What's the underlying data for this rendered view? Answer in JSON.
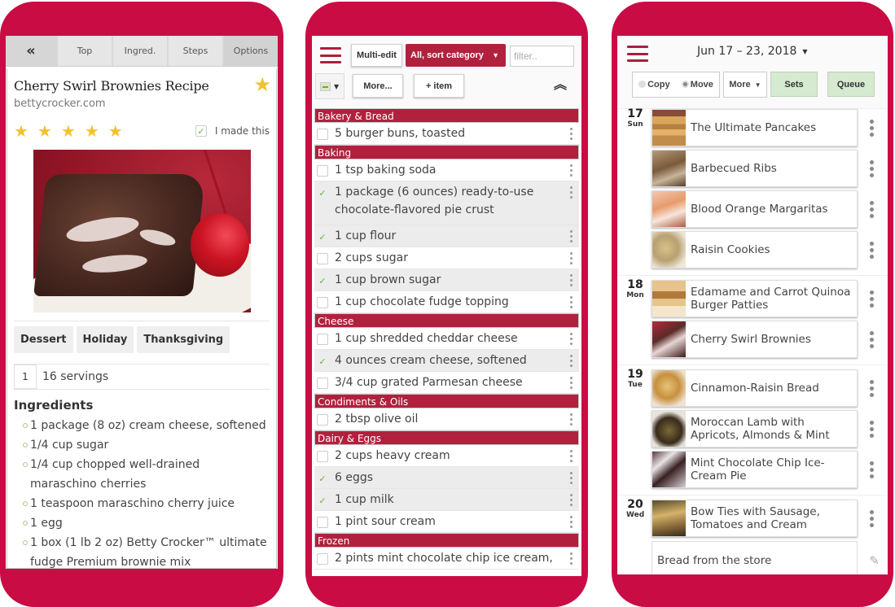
{
  "colors": {
    "brand": "#c90c44",
    "category_header": "#b1213e",
    "star": "#f2c12e",
    "check": "#6cae3c",
    "green_button": "#d5ead0"
  },
  "recipe": {
    "tabs": [
      {
        "label": "«",
        "icon": "double-chevron-left-icon"
      },
      {
        "label": "Top"
      },
      {
        "label": "Ingred."
      },
      {
        "label": "Steps"
      },
      {
        "label": "Options"
      }
    ],
    "title": "Cherry Swirl Brownies Recipe",
    "source": "bettycrocker.com",
    "favorite": true,
    "rating": 5,
    "rating_max": 5,
    "made_this_label": "I made this",
    "made_this_checked": true,
    "photo_alt": "Cherry swirl brownie with maraschino cherry",
    "tags": [
      "Dessert",
      "Holiday",
      "Thanksgiving"
    ],
    "servings_multiplier": "1",
    "servings_label": "16 servings",
    "ingredients_title": "Ingredients",
    "ingredients": [
      "1 package (8 oz) cream cheese, softened",
      "1/4 cup sugar",
      "1/4 cup chopped well-drained maraschino cherries",
      "1 teaspoon maraschino cherry juice",
      "1 egg",
      "1 box (1 lb 2 oz) Betty Crocker™ ultimate fudge Premium brownie mix"
    ]
  },
  "shopping": {
    "multi_edit_label": "Multi-edit",
    "sort_label": "All, sort category",
    "filter_placeholder": "filter..",
    "more_label": "More...",
    "add_item_label": "+ item",
    "categories": [
      {
        "name": "Bakery & Bread",
        "items": [
          {
            "text": "5 burger buns, toasted",
            "checked": false
          }
        ]
      },
      {
        "name": "Baking",
        "items": [
          {
            "text": "1 tsp baking soda",
            "checked": false
          },
          {
            "text": "1 package (6 ounces) ready-to-use chocolate-flavored pie crust",
            "checked": true
          },
          {
            "text": "1 cup flour",
            "checked": true
          },
          {
            "text": "2 cups sugar",
            "checked": false
          },
          {
            "text": "1 cup brown sugar",
            "checked": true
          },
          {
            "text": "1 cup chocolate fudge topping",
            "checked": false
          }
        ]
      },
      {
        "name": "Cheese",
        "items": [
          {
            "text": "1 cup shredded cheddar cheese",
            "checked": false
          },
          {
            "text": "4 ounces cream cheese, softened",
            "checked": true
          },
          {
            "text": "3/4 cup grated Parmesan cheese",
            "checked": false
          }
        ]
      },
      {
        "name": "Condiments & Oils",
        "items": [
          {
            "text": "2 tbsp olive oil",
            "checked": false
          }
        ]
      },
      {
        "name": "Dairy & Eggs",
        "items": [
          {
            "text": "2 cups heavy cream",
            "checked": false
          },
          {
            "text": "6 eggs",
            "checked": true
          },
          {
            "text": "1 cup milk",
            "checked": true
          },
          {
            "text": "1 pint sour cream",
            "checked": false
          }
        ]
      },
      {
        "name": "Frozen",
        "items": [
          {
            "text": "2 pints mint chocolate chip ice cream,",
            "checked": false
          }
        ]
      }
    ]
  },
  "planner": {
    "date_range": "Jun 17 – 23, 2018",
    "copy_label": "Copy",
    "move_label": "Move",
    "mode_selected": "Move",
    "more_label": "More",
    "sets_label": "Sets",
    "queue_label": "Queue",
    "days": [
      {
        "num": "17",
        "dow": "Sun",
        "meals": [
          {
            "name": "The Ultimate Pancakes",
            "thumb": "t-pancake"
          },
          {
            "name": "Barbecued Ribs",
            "thumb": "t-ribs"
          },
          {
            "name": "Blood Orange Margaritas",
            "thumb": "t-marg"
          },
          {
            "name": "Raisin Cookies",
            "thumb": "t-cookie"
          }
        ]
      },
      {
        "num": "18",
        "dow": "Mon",
        "meals": [
          {
            "name": "Edamame and Carrot Quinoa Burger Patties",
            "thumb": "t-burger"
          },
          {
            "name": "Cherry Swirl Brownies",
            "thumb": "t-brownie"
          }
        ]
      },
      {
        "num": "19",
        "dow": "Tue",
        "meals": [
          {
            "name": "Cinnamon-Raisin Bread",
            "thumb": "t-bread"
          },
          {
            "name": "Moroccan Lamb with Apricots, Almonds & Mint",
            "thumb": "t-lamb"
          },
          {
            "name": "Mint Chocolate Chip Ice-Cream Pie",
            "thumb": "t-pie"
          }
        ]
      },
      {
        "num": "20",
        "dow": "Wed",
        "meals": [
          {
            "name": "Bow Ties with Sausage, Tomatoes and Cream",
            "thumb": "t-bowtie"
          }
        ],
        "note": "Bread from the store"
      }
    ]
  }
}
